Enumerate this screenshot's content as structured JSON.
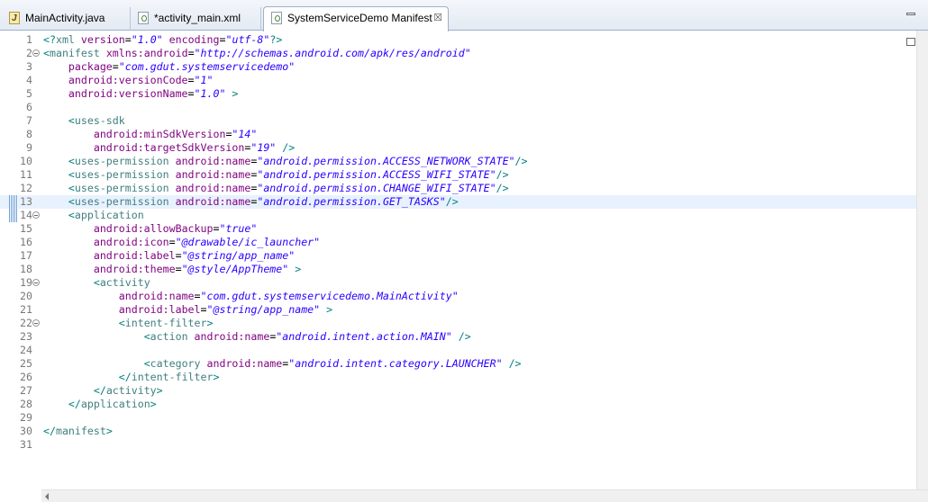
{
  "tabs": [
    {
      "label": "MainActivity.java",
      "icon": "java-file-icon",
      "active": false
    },
    {
      "label": "*activity_main.xml",
      "icon": "xml-file-icon",
      "active": false
    },
    {
      "label": "SystemServiceDemo Manifest",
      "icon": "xml-file-icon",
      "active": true,
      "close": "☒"
    }
  ],
  "editor": {
    "current_line": 13,
    "lines": [
      {
        "n": "1",
        "fold": false,
        "tokens": [
          [
            "bracket",
            "<?"
          ],
          [
            "tag",
            "xml"
          ],
          [
            "text",
            " "
          ],
          [
            "attr",
            "version"
          ],
          [
            "eq",
            "="
          ],
          [
            "val",
            "\"1.0\""
          ],
          [
            "text",
            " "
          ],
          [
            "attr",
            "encoding"
          ],
          [
            "eq",
            "="
          ],
          [
            "val",
            "\"utf-8\""
          ],
          [
            "bracket",
            "?>"
          ]
        ]
      },
      {
        "n": "2",
        "fold": true,
        "tokens": [
          [
            "bracket",
            "<"
          ],
          [
            "tag",
            "manifest"
          ],
          [
            "text",
            " "
          ],
          [
            "attr",
            "xmlns:android"
          ],
          [
            "eq",
            "="
          ],
          [
            "val",
            "\"http://schemas.android.com/apk/res/android\""
          ]
        ]
      },
      {
        "n": "3",
        "fold": false,
        "tokens": [
          [
            "text",
            "    "
          ],
          [
            "attr",
            "package"
          ],
          [
            "eq",
            "="
          ],
          [
            "val",
            "\"com.gdut.systemservicedemo\""
          ]
        ]
      },
      {
        "n": "4",
        "fold": false,
        "tokens": [
          [
            "text",
            "    "
          ],
          [
            "attr",
            "android:versionCode"
          ],
          [
            "eq",
            "="
          ],
          [
            "val",
            "\"1\""
          ]
        ]
      },
      {
        "n": "5",
        "fold": false,
        "tokens": [
          [
            "text",
            "    "
          ],
          [
            "attr",
            "android:versionName"
          ],
          [
            "eq",
            "="
          ],
          [
            "val",
            "\"1.0\""
          ],
          [
            "text",
            " "
          ],
          [
            "bracket",
            ">"
          ]
        ]
      },
      {
        "n": "6",
        "fold": false,
        "tokens": []
      },
      {
        "n": "7",
        "fold": false,
        "tokens": [
          [
            "text",
            "    "
          ],
          [
            "bracket",
            "<"
          ],
          [
            "tag",
            "uses-sdk"
          ]
        ]
      },
      {
        "n": "8",
        "fold": false,
        "tokens": [
          [
            "text",
            "        "
          ],
          [
            "attr",
            "android:minSdkVersion"
          ],
          [
            "eq",
            "="
          ],
          [
            "val",
            "\"14\""
          ]
        ]
      },
      {
        "n": "9",
        "fold": false,
        "tokens": [
          [
            "text",
            "        "
          ],
          [
            "attr",
            "android:targetSdkVersion"
          ],
          [
            "eq",
            "="
          ],
          [
            "val",
            "\"19\""
          ],
          [
            "text",
            " "
          ],
          [
            "bracket",
            "/>"
          ]
        ]
      },
      {
        "n": "10",
        "fold": false,
        "tokens": [
          [
            "text",
            "    "
          ],
          [
            "bracket",
            "<"
          ],
          [
            "tag",
            "uses-permission"
          ],
          [
            "text",
            " "
          ],
          [
            "attr",
            "android:name"
          ],
          [
            "eq",
            "="
          ],
          [
            "val",
            "\"android.permission.ACCESS_NETWORK_STATE\""
          ],
          [
            "bracket",
            "/>"
          ]
        ]
      },
      {
        "n": "11",
        "fold": false,
        "tokens": [
          [
            "text",
            "    "
          ],
          [
            "bracket",
            "<"
          ],
          [
            "tag",
            "uses-permission"
          ],
          [
            "text",
            " "
          ],
          [
            "attr",
            "android:name"
          ],
          [
            "eq",
            "="
          ],
          [
            "val",
            "\"android.permission.ACCESS_WIFI_STATE\""
          ],
          [
            "bracket",
            "/>"
          ]
        ]
      },
      {
        "n": "12",
        "fold": false,
        "tokens": [
          [
            "text",
            "    "
          ],
          [
            "bracket",
            "<"
          ],
          [
            "tag",
            "uses-permission"
          ],
          [
            "text",
            " "
          ],
          [
            "attr",
            "android:name"
          ],
          [
            "eq",
            "="
          ],
          [
            "val",
            "\"android.permission.CHANGE_WIFI_STATE\""
          ],
          [
            "bracket",
            "/>"
          ]
        ]
      },
      {
        "n": "13",
        "fold": false,
        "tokens": [
          [
            "text",
            "    "
          ],
          [
            "bracket",
            "<"
          ],
          [
            "tag",
            "uses-permission"
          ],
          [
            "text",
            " "
          ],
          [
            "attr",
            "android:name"
          ],
          [
            "eq",
            "="
          ],
          [
            "val",
            "\"android.permission.GET_TASKS\""
          ],
          [
            "bracket",
            "/>"
          ]
        ]
      },
      {
        "n": "14",
        "fold": true,
        "tokens": [
          [
            "text",
            "    "
          ],
          [
            "bracket",
            "<"
          ],
          [
            "tag",
            "application"
          ]
        ]
      },
      {
        "n": "15",
        "fold": false,
        "tokens": [
          [
            "text",
            "        "
          ],
          [
            "attr",
            "android:allowBackup"
          ],
          [
            "eq",
            "="
          ],
          [
            "val",
            "\"true\""
          ]
        ]
      },
      {
        "n": "16",
        "fold": false,
        "tokens": [
          [
            "text",
            "        "
          ],
          [
            "attr",
            "android:icon"
          ],
          [
            "eq",
            "="
          ],
          [
            "val",
            "\"@drawable/ic_launcher\""
          ]
        ]
      },
      {
        "n": "17",
        "fold": false,
        "tokens": [
          [
            "text",
            "        "
          ],
          [
            "attr",
            "android:label"
          ],
          [
            "eq",
            "="
          ],
          [
            "val",
            "\"@string/app_name\""
          ]
        ]
      },
      {
        "n": "18",
        "fold": false,
        "tokens": [
          [
            "text",
            "        "
          ],
          [
            "attr",
            "android:theme"
          ],
          [
            "eq",
            "="
          ],
          [
            "val",
            "\"@style/AppTheme\""
          ],
          [
            "text",
            " "
          ],
          [
            "bracket",
            ">"
          ]
        ]
      },
      {
        "n": "19",
        "fold": true,
        "tokens": [
          [
            "text",
            "        "
          ],
          [
            "bracket",
            "<"
          ],
          [
            "tag",
            "activity"
          ]
        ]
      },
      {
        "n": "20",
        "fold": false,
        "tokens": [
          [
            "text",
            "            "
          ],
          [
            "attr",
            "android:name"
          ],
          [
            "eq",
            "="
          ],
          [
            "val",
            "\"com.gdut.systemservicedemo.MainActivity\""
          ]
        ]
      },
      {
        "n": "21",
        "fold": false,
        "tokens": [
          [
            "text",
            "            "
          ],
          [
            "attr",
            "android:label"
          ],
          [
            "eq",
            "="
          ],
          [
            "val",
            "\"@string/app_name\""
          ],
          [
            "text",
            " "
          ],
          [
            "bracket",
            ">"
          ]
        ]
      },
      {
        "n": "22",
        "fold": true,
        "tokens": [
          [
            "text",
            "            "
          ],
          [
            "bracket",
            "<"
          ],
          [
            "tag",
            "intent-filter"
          ],
          [
            "bracket",
            ">"
          ]
        ]
      },
      {
        "n": "23",
        "fold": false,
        "tokens": [
          [
            "text",
            "                "
          ],
          [
            "bracket",
            "<"
          ],
          [
            "tag",
            "action"
          ],
          [
            "text",
            " "
          ],
          [
            "attr",
            "android:name"
          ],
          [
            "eq",
            "="
          ],
          [
            "val",
            "\"android.intent.action.MAIN\""
          ],
          [
            "text",
            " "
          ],
          [
            "bracket",
            "/>"
          ]
        ]
      },
      {
        "n": "24",
        "fold": false,
        "tokens": []
      },
      {
        "n": "25",
        "fold": false,
        "tokens": [
          [
            "text",
            "                "
          ],
          [
            "bracket",
            "<"
          ],
          [
            "tag",
            "category"
          ],
          [
            "text",
            " "
          ],
          [
            "attr",
            "android:name"
          ],
          [
            "eq",
            "="
          ],
          [
            "val",
            "\"android.intent.category.LAUNCHER\""
          ],
          [
            "text",
            " "
          ],
          [
            "bracket",
            "/>"
          ]
        ]
      },
      {
        "n": "26",
        "fold": false,
        "tokens": [
          [
            "text",
            "            "
          ],
          [
            "bracket",
            "</"
          ],
          [
            "tag",
            "intent-filter"
          ],
          [
            "bracket",
            ">"
          ]
        ]
      },
      {
        "n": "27",
        "fold": false,
        "tokens": [
          [
            "text",
            "        "
          ],
          [
            "bracket",
            "</"
          ],
          [
            "tag",
            "activity"
          ],
          [
            "bracket",
            ">"
          ]
        ]
      },
      {
        "n": "28",
        "fold": false,
        "tokens": [
          [
            "text",
            "    "
          ],
          [
            "bracket",
            "</"
          ],
          [
            "tag",
            "application"
          ],
          [
            "bracket",
            ">"
          ]
        ]
      },
      {
        "n": "29",
        "fold": false,
        "tokens": []
      },
      {
        "n": "30",
        "fold": false,
        "tokens": [
          [
            "bracket",
            "</"
          ],
          [
            "tag",
            "manifest"
          ],
          [
            "bracket",
            ">"
          ]
        ]
      },
      {
        "n": "31",
        "fold": false,
        "tokens": []
      }
    ]
  },
  "colors": {
    "bracket": "#008080",
    "tag": "#3f7f7f",
    "attr": "#7f007f",
    "value": "#2a00ff",
    "current_line_bg": "#e8f2fe"
  }
}
